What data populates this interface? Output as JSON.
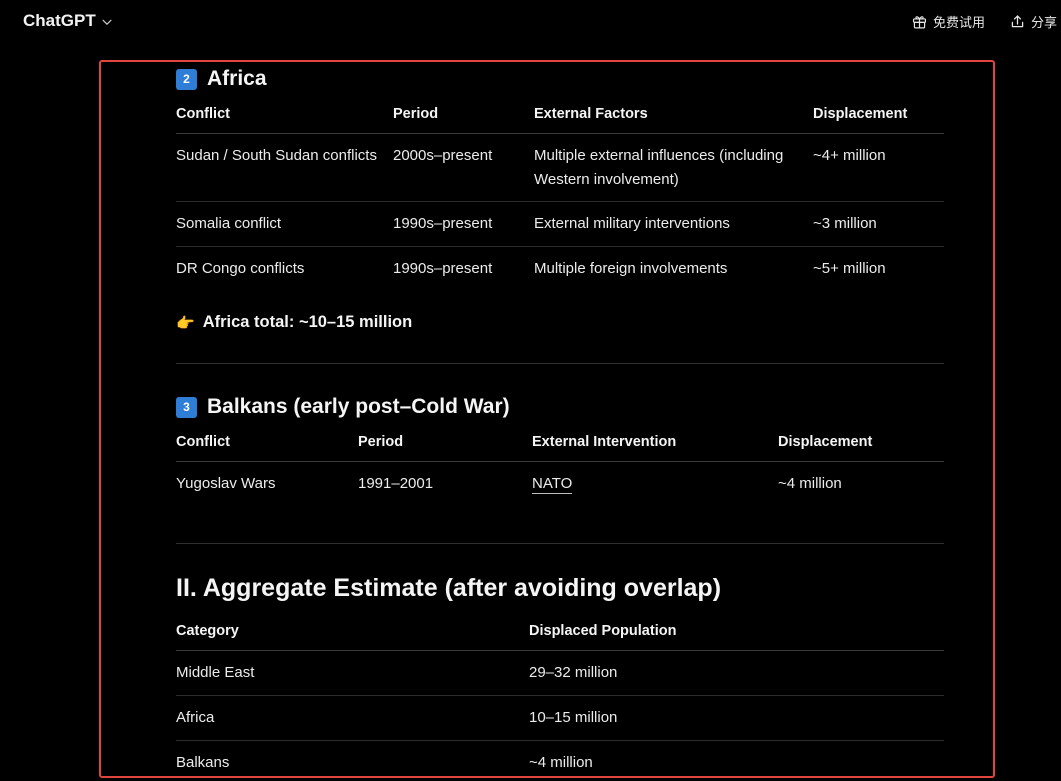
{
  "header": {
    "brand": "ChatGPT",
    "actions": [
      {
        "label": "免费试用",
        "icon": "gift-icon"
      },
      {
        "label": "分享",
        "icon": "share-icon"
      }
    ]
  },
  "africa": {
    "badge": "2",
    "title": "Africa",
    "columns": [
      "Conflict",
      "Period",
      "External Factors",
      "Displacement"
    ],
    "rows": [
      [
        "Sudan / South Sudan conflicts",
        "2000s–present",
        "Multiple external influences (including Western involvement)",
        "~4+ million"
      ],
      [
        "Somalia conflict",
        "1990s–present",
        "External military interventions",
        "~3 million"
      ],
      [
        "DR Congo conflicts",
        "1990s–present",
        "Multiple foreign involvements",
        "~5+ million"
      ]
    ],
    "total_icon": "👉",
    "total": "Africa total: ~10–15 million"
  },
  "balkans": {
    "badge": "3",
    "title": "Balkans (early post–Cold War)",
    "columns": [
      "Conflict",
      "Period",
      "External Intervention",
      "Displacement"
    ],
    "rows": [
      [
        "Yugoslav Wars",
        "1991–2001",
        "NATO",
        "~4 million"
      ]
    ]
  },
  "aggregate": {
    "title": "II. Aggregate Estimate (after avoiding overlap)",
    "columns": [
      "Category",
      "Displaced Population"
    ],
    "rows": [
      [
        "Middle East",
        "29–32 million"
      ],
      [
        "Africa",
        "10–15 million"
      ],
      [
        "Balkans",
        "~4 million"
      ]
    ]
  }
}
